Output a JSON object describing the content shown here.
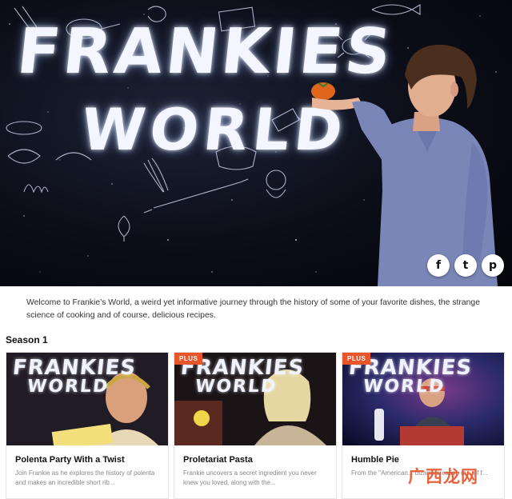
{
  "hero": {
    "title_line1": "FRANKIES",
    "title_line2": "WORLD",
    "share": [
      {
        "icon": "facebook-icon",
        "glyph": "f"
      },
      {
        "icon": "twitter-icon",
        "glyph": "t"
      },
      {
        "icon": "pinterest-icon",
        "glyph": "p"
      }
    ]
  },
  "intro": {
    "text": "Welcome to Frankie's World, a weird yet informative journey through the history of some of your favorite dishes, the strange science of cooking and of course, delicious recipes."
  },
  "season": {
    "label": "Season 1"
  },
  "episodes": [
    {
      "title": "Polenta Party With a Twist",
      "description": "Join Frankie as he explores the history of polenta and makes an incredible short rib...",
      "badge": "",
      "logo1": "FRANKIES",
      "logo2": "WORLD"
    },
    {
      "title": "Proletariat Pasta",
      "description": "Frankie uncovers a secret ingredient you never knew you loved, along with the...",
      "badge": "PLUS",
      "logo1": "FRANKIES",
      "logo2": "WORLD"
    },
    {
      "title": "Humble Pie",
      "description": "From the \"American... bizarre creation m... of f...",
      "badge": "PLUS",
      "logo1": "FRANKIES",
      "logo2": "WORLD"
    }
  ],
  "watermark": {
    "text": "广西龙网"
  },
  "colors": {
    "accent": "#e8552b",
    "hero_bg": "#0b0d17",
    "shirt": "#7a86b8"
  }
}
